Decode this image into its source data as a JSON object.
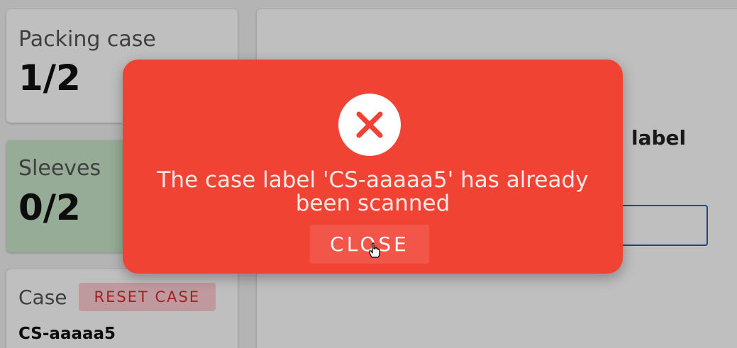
{
  "packing": {
    "label": "Packing case",
    "count": "1/2"
  },
  "sleeves": {
    "label": "Sleeves",
    "count": "0/2"
  },
  "case": {
    "label": "Case",
    "reset_label": "RESET CASE",
    "id": "CS-aaaaa5"
  },
  "main": {
    "label": "label"
  },
  "modal": {
    "icon": "error-x-icon",
    "message": "The case label 'CS-aaaaa5' has already been scanned",
    "close_label": "CLOSE"
  },
  "colors": {
    "modal_bg": "#f14334",
    "sleeves_bg": "#c8e6c9",
    "reset_bg": "#ffcdd2",
    "reset_text": "#d32f2f",
    "input_border": "#1565c0"
  }
}
